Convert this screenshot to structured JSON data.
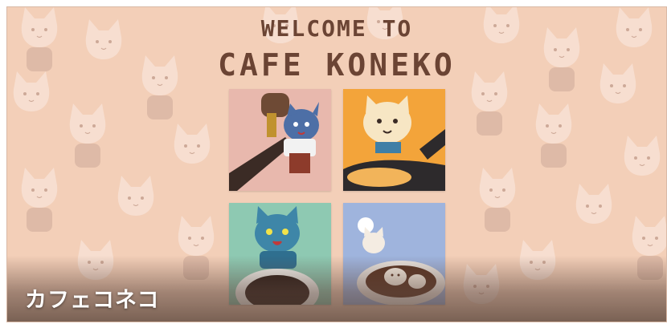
{
  "banner": {
    "title_line1": "WELCOME TO",
    "title_line2": "CAFE KONEKO",
    "caption": "カフェコネコ"
  },
  "colors": {
    "background": "#f3cfb8",
    "title": "#6b4434",
    "caption": "#ffffff"
  },
  "tiles": [
    {
      "subject": "barista-cat-with-espresso-icon",
      "background": "#e8b8ad"
    },
    {
      "subject": "cream-cat-on-pan-icon",
      "background": "#f3a43a"
    },
    {
      "subject": "blue-cat-with-coffee-cup-icon",
      "background": "#8ec9b2"
    },
    {
      "subject": "latte-art-cats-icon",
      "background": "#9fb4dd"
    }
  ]
}
